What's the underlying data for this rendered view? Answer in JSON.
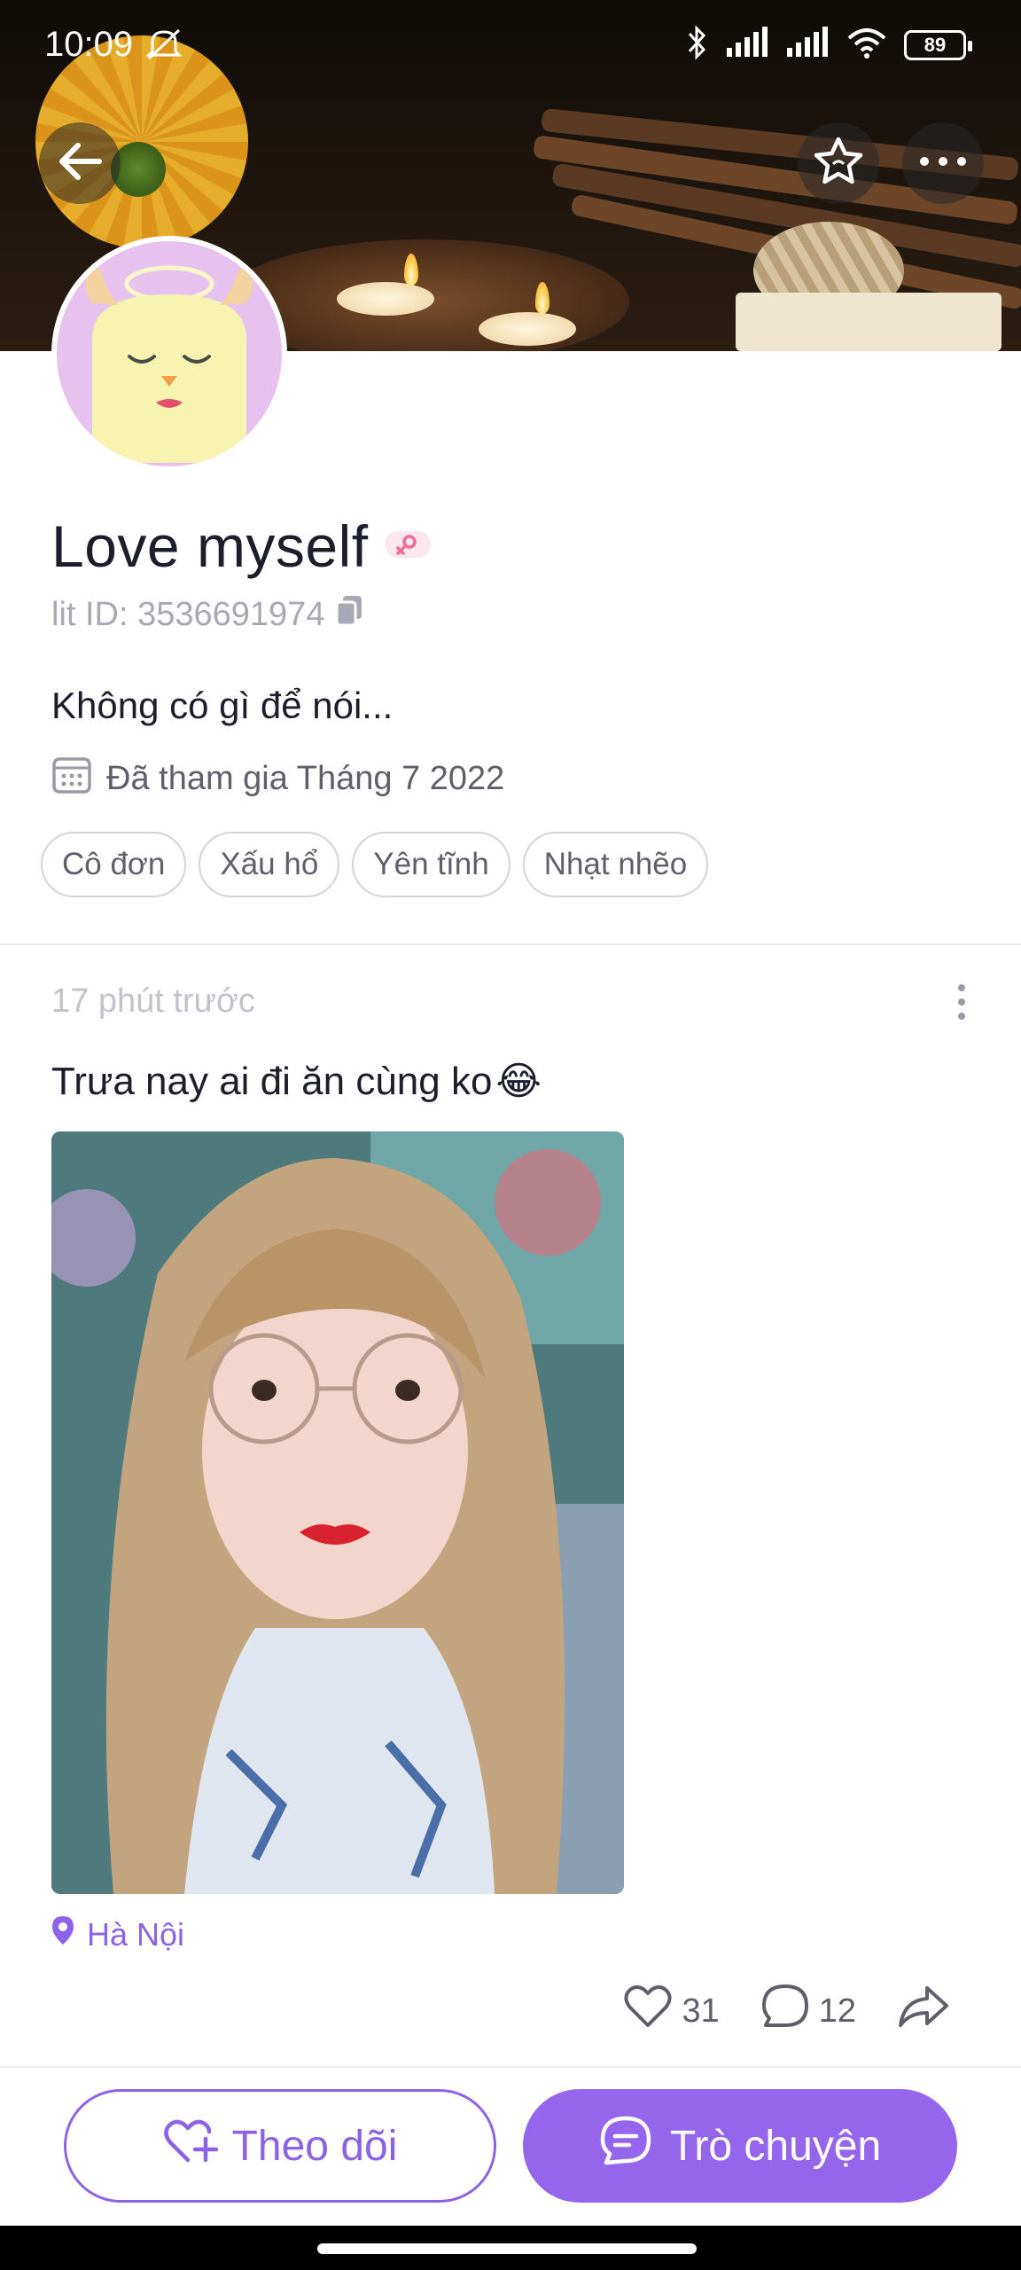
{
  "status_bar": {
    "time": "10:09",
    "battery": "89"
  },
  "profile": {
    "name": "Love myself",
    "lit_id": "lit ID: 3536691974",
    "bio": "Không có gì để nói...",
    "joined": "Đã tham gia Tháng 7 2022",
    "tags": [
      "Cô đơn",
      "Xấu hổ",
      "Yên tĩnh",
      "Nhạt nhẽo"
    ]
  },
  "post": {
    "time": "17 phút trước",
    "text": "Trưa nay ai đi ăn cùng ko",
    "emoji": "😂",
    "location": "Hà Nội",
    "likes": "31",
    "comments": "12"
  },
  "buttons": {
    "follow": "Theo dõi",
    "chat": "Trò chuyện"
  },
  "colors": {
    "accent": "#9566ec",
    "accent_text": "#8c62e6"
  },
  "icons": [
    "back-arrow-icon",
    "star-icon",
    "more-icon",
    "copy-icon",
    "calendar-icon",
    "location-pin-icon",
    "heart-icon",
    "comment-icon",
    "share-icon",
    "heart-plus-icon",
    "chat-icon",
    "gender-icon"
  ]
}
